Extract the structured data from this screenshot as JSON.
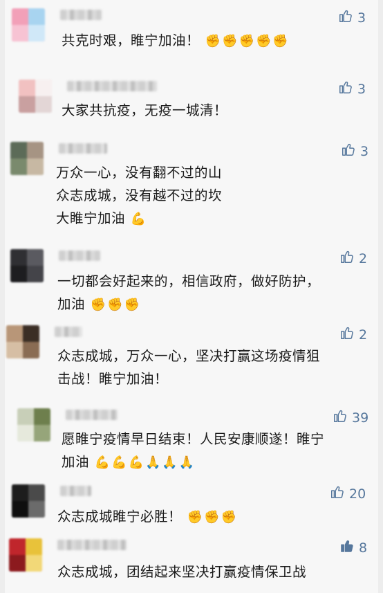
{
  "comments": [
    {
      "text_lines": [
        "共克时艰，睢宁加油！"
      ],
      "emoji": "✊✊✊✊✊",
      "likes": "3",
      "liked": false,
      "avatar": [
        "#f2a0b8",
        "#a8d4f0",
        "#f7c3d3",
        "#d0e8f8"
      ]
    },
    {
      "text_lines": [
        "大家共抗疫，无疫一城清！"
      ],
      "emoji": "",
      "likes": "3",
      "liked": false,
      "avatar": [
        "#f1c1c1",
        "#f7f0f0",
        "#c9a0a0",
        "#e3d6d6"
      ]
    },
    {
      "text_lines": [
        "万众一心，没有翻不过的山",
        "众志成城，没有越不过的坎",
        "大睢宁加油"
      ],
      "emoji": "💪",
      "likes": "3",
      "liked": false,
      "avatar": [
        "#5c6b58",
        "#a69483",
        "#7a8a6d",
        "#c7b8a3"
      ]
    },
    {
      "text_lines": [
        "一切都会好起来的，相信政府，做好防护，",
        "加油"
      ],
      "emoji": "✊✊✊",
      "likes": "2",
      "liked": false,
      "avatar": [
        "#2f2f33",
        "#5a5a60",
        "#1d1d20",
        "#444449"
      ]
    },
    {
      "text_lines": [
        "众志成城，万众一心，坚决打赢这场疫情狙",
        "击战！睢宁加油！"
      ],
      "emoji": "",
      "likes": "2",
      "liked": false,
      "avatar": [
        "#b89678",
        "#3b2e25",
        "#d6bea4",
        "#8a6c53"
      ]
    },
    {
      "text_lines": [
        "愿睢宁疫情早日结束！人民安康顺遂！睢宁",
        "加油"
      ],
      "emoji": "💪💪💪🙏🙏🙏",
      "likes": "39",
      "liked": false,
      "avatar": [
        "#c8cfb8",
        "#6e7f4d",
        "#e6e9dc",
        "#96a57a"
      ]
    },
    {
      "text_lines": [
        "众志成城睢宁必胜！"
      ],
      "emoji": "✊✊✊",
      "likes": "20",
      "liked": false,
      "avatar": [
        "#1d1d1d",
        "#4a4a4a",
        "#0f0f0f",
        "#6b6b6b"
      ]
    },
    {
      "text_lines": [
        "众志成城，团结起来坚决打赢疫情保卫战"
      ],
      "emoji": "",
      "likes": "8",
      "liked": true,
      "avatar": [
        "#c0262c",
        "#e8c23a",
        "#8c1a1e",
        "#f2d878"
      ]
    }
  ],
  "colors": {
    "like_blue": "#56779c",
    "text": "#1a1a1a",
    "background": "#f7f7f7"
  }
}
